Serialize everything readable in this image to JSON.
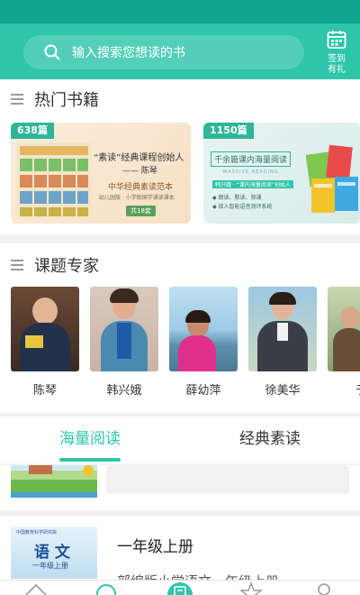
{
  "search": {
    "placeholder": "输入搜索您想读的书",
    "icon": "search-icon"
  },
  "signin": {
    "label_line1": "签到",
    "label_line2": "有礼",
    "icon": "calendar-icon"
  },
  "hot_books": {
    "title": "热门书籍",
    "cards": [
      {
        "badge": "638篇",
        "headline": "“素读”经典课程创始人",
        "author": "—— 陈琴",
        "subtitle": "中华经典素读范本",
        "tagline": "幼儿园版 · 小学版国学诵读课本",
        "count": "共18套"
      },
      {
        "badge": "1150篇",
        "headline": "千余篇课内海量阅读",
        "subheadline": "MASSIVE READING",
        "note1": "韩兴娥 · “课内海量阅读”创始人",
        "note2": "◆ 朗读、默读、背诵",
        "note3": "◆ 接入智能语音测评系统"
      }
    ]
  },
  "experts": {
    "title": "课题专家",
    "people": [
      {
        "name": "陈琴"
      },
      {
        "name": "韩兴娥"
      },
      {
        "name": "薛幼萍"
      },
      {
        "name": "徐美华"
      },
      {
        "name": "于"
      }
    ]
  },
  "tabs": {
    "items": [
      "海量阅读",
      "经典素读"
    ],
    "active": 0
  },
  "list": {
    "items": [
      {
        "title": "",
        "desc": ""
      },
      {
        "cover_title": "语 文",
        "cover_sub": "一年级上册",
        "cover_publisher": "中国教育科学研究院",
        "title": "一年级上册",
        "desc": "部编版小学语文一年级上册"
      }
    ]
  },
  "bottom_nav": {
    "icons": [
      "home-icon",
      "discover-icon",
      "book-icon",
      "star-icon",
      "profile-icon"
    ]
  },
  "colors": {
    "primary": "#2ec5aa",
    "statusbar": "#12a48f",
    "badge": "#2fb597"
  }
}
